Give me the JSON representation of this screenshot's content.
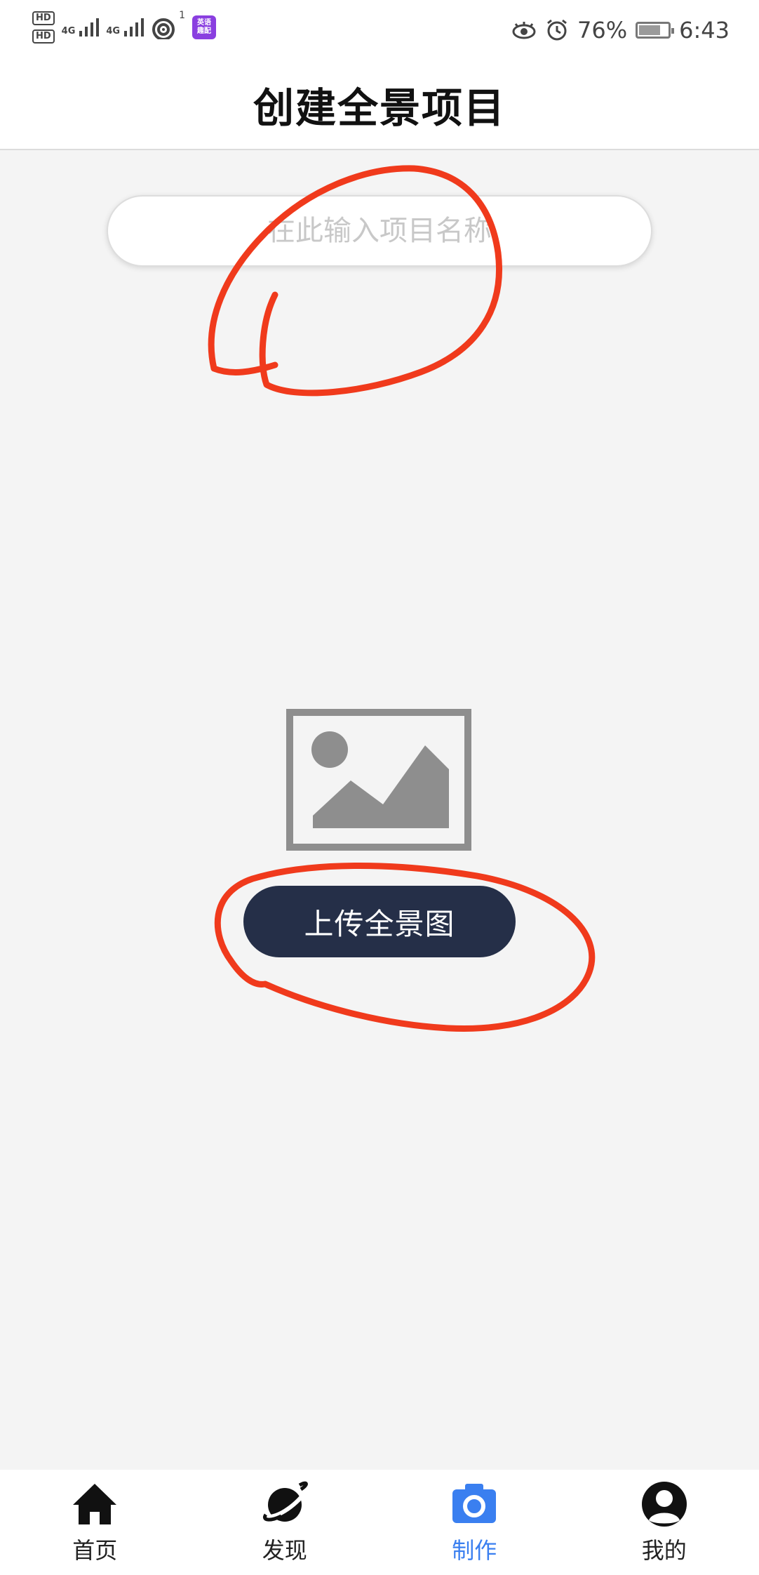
{
  "status_bar": {
    "hd1": "HD",
    "hd2": "HD",
    "sim1": "4G",
    "sim2": "4G",
    "sup": "1",
    "app_icon_text": "英语\n趣配",
    "battery_percent": "76%",
    "battery_level": 0.76,
    "time": "6:43",
    "icons": [
      "eye-comfort-icon",
      "alarm-icon",
      "wifi-icon",
      "signal-icon",
      "battery-icon"
    ]
  },
  "header": {
    "title": "创建全景项目"
  },
  "form": {
    "project_name_placeholder": "在此输入项目名称",
    "project_name_value": ""
  },
  "upload": {
    "image_icon": "image-placeholder-icon",
    "button_label": "上传全景图"
  },
  "tabbar": {
    "tabs": [
      {
        "label": "首页",
        "icon": "home-icon",
        "active": false
      },
      {
        "label": "发现",
        "icon": "planet-icon",
        "active": false
      },
      {
        "label": "制作",
        "icon": "camera-icon",
        "active": true
      },
      {
        "label": "我的",
        "icon": "user-icon",
        "active": false
      }
    ]
  },
  "colors": {
    "accent": "#3a7ff0",
    "button_bg": "#252f48",
    "annotation": "#f03a1c",
    "background": "#f4f4f4"
  }
}
